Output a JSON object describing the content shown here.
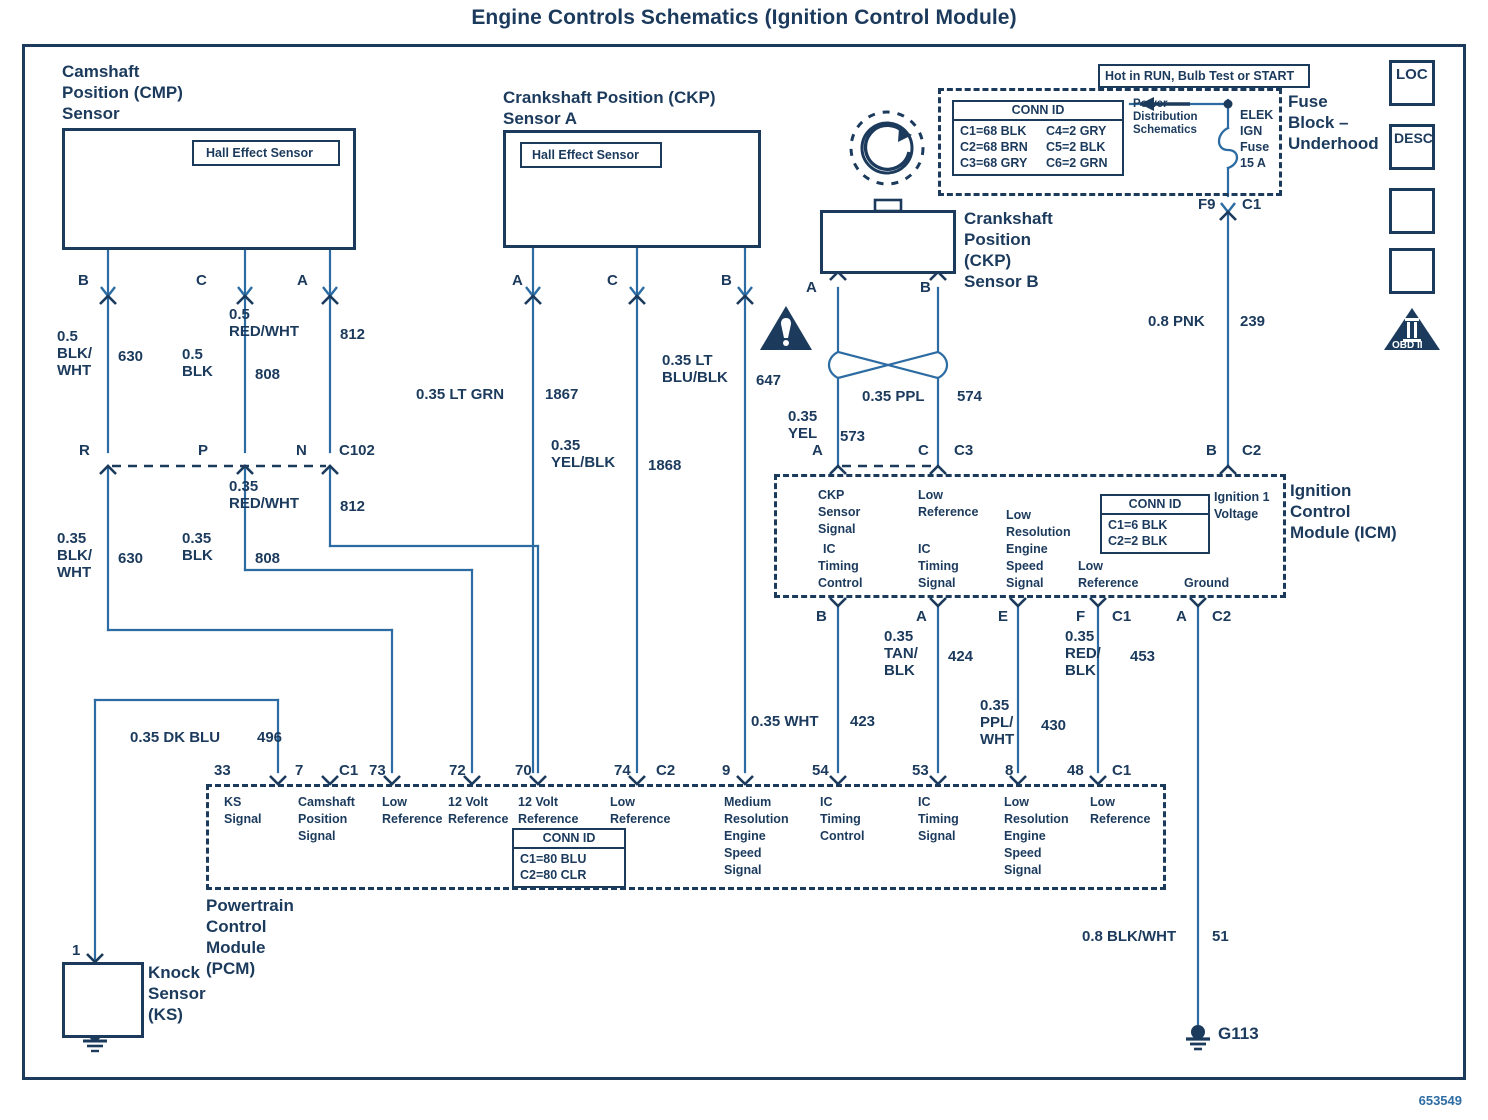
{
  "title": "Engine Controls Schematics (Ignition Control Module)",
  "doc_id": "653549",
  "components": {
    "cmp_sensor": {
      "name_line1": "Camshaft",
      "name_line2": "Position (CMP)",
      "name_line3": "Sensor",
      "inner_label": "Hall Effect Sensor",
      "pins": [
        "B",
        "C",
        "A"
      ]
    },
    "ckp_sensor_a": {
      "name_line1": "Crankshaft Position (CKP)",
      "name_line2": "Sensor A",
      "inner_label": "Hall Effect Sensor",
      "pins": [
        "A",
        "C",
        "B"
      ]
    },
    "ckp_sensor_b": {
      "name_line1": "Crankshaft",
      "name_line2": "Position",
      "name_line3": "(CKP)",
      "name_line4": "Sensor B",
      "pins": [
        "A",
        "B"
      ]
    },
    "knock_sensor": {
      "name_line1": "Knock",
      "name_line2": "Sensor",
      "name_line3": "(KS)",
      "pin": "1"
    },
    "fuse_block": {
      "hot_label": "Hot in RUN, Bulb Test or START",
      "name_line1": "Fuse",
      "name_line2": "Block –",
      "name_line3": "Underhood",
      "power_dist_line1": "Power",
      "power_dist_line2": "Distribution",
      "power_dist_line3": "Schematics",
      "fuse_line1": "ELEK",
      "fuse_line2": "IGN",
      "fuse_line3": "Fuse",
      "fuse_line4": "15 A",
      "out_pin": "F9",
      "out_conn": "C1",
      "conn_id": {
        "title": "CONN ID",
        "rows": [
          [
            "C1=68 BLK",
            "C4=2 GRY"
          ],
          [
            "C2=68 BRN",
            "C5=2 BLK"
          ],
          [
            "C3=68 GRY",
            "C6=2 GRN"
          ]
        ]
      }
    },
    "icm": {
      "name_line1": "Ignition",
      "name_line2": "Control",
      "name_line3": "Module (ICM)",
      "conn_id": {
        "title": "CONN ID",
        "rows": [
          [
            "C1=6 BLK"
          ],
          [
            "C2=2 BLK"
          ]
        ]
      },
      "top_pins": [
        {
          "pin": "A",
          "conn": "",
          "lines": [
            "CKP",
            "Sensor",
            "Signal"
          ],
          "lines2": [
            "IC",
            "Timing",
            "Control"
          ]
        },
        {
          "pin": "C",
          "conn": "C3",
          "lines": [
            "Low",
            "Reference"
          ],
          "lines2": [
            "IC",
            "Timing",
            "Signal"
          ]
        },
        {
          "pin": "B",
          "conn": "C2",
          "lines": [
            "Ignition 1",
            "Voltage"
          ]
        }
      ],
      "mid_label_low_res": [
        "Low",
        "Resolution",
        "Engine",
        "Speed",
        "Signal"
      ],
      "bottom_pins": [
        {
          "pin": "B",
          "conn": ""
        },
        {
          "pin": "A",
          "conn": ""
        },
        {
          "pin": "E",
          "conn": ""
        },
        {
          "pin": "F",
          "conn": "C1",
          "lines": [
            "Low",
            "Reference"
          ]
        },
        {
          "pin": "A",
          "conn": "C2",
          "lines": [
            "Ground"
          ]
        }
      ]
    },
    "pcm": {
      "name_line1": "Powertrain",
      "name_line2": "Control",
      "name_line3": "Module",
      "name_line4": "(PCM)",
      "conn_id": {
        "title": "CONN ID",
        "rows": [
          [
            "C1=80 BLU"
          ],
          [
            "C2=80 CLR"
          ]
        ]
      },
      "terminals": [
        {
          "pin": "33",
          "conn": "",
          "lines": [
            "KS",
            "Signal"
          ]
        },
        {
          "pin": "7",
          "conn": "C1",
          "lines": [
            "Camshaft",
            "Position",
            "Signal"
          ]
        },
        {
          "pin": "73",
          "conn": "",
          "lines": [
            "Low",
            "Reference"
          ]
        },
        {
          "pin": "72",
          "conn": "",
          "lines": [
            "12 Volt",
            "Reference"
          ]
        },
        {
          "pin": "70",
          "conn": "",
          "lines": [
            "12 Volt",
            "Reference"
          ]
        },
        {
          "pin": "74",
          "conn": "C2",
          "lines": [
            "Low",
            "Reference"
          ]
        },
        {
          "pin": "9",
          "conn": "",
          "lines": [
            "Medium",
            "Resolution",
            "Engine",
            "Speed",
            "Signal"
          ]
        },
        {
          "pin": "54",
          "conn": "",
          "lines": [
            "IC",
            "Timing",
            "Control"
          ]
        },
        {
          "pin": "53",
          "conn": "",
          "lines": [
            "IC",
            "Timing",
            "Signal"
          ]
        },
        {
          "pin": "8",
          "conn": "",
          "lines": [
            "Low",
            "Resolution",
            "Engine",
            "Speed",
            "Signal"
          ]
        },
        {
          "pin": "48",
          "conn": "C1",
          "lines": [
            "Low",
            "Reference"
          ]
        }
      ]
    },
    "connector_c102": {
      "label": "C102",
      "pins": [
        "R",
        "P",
        "N"
      ]
    },
    "ground": {
      "label": "G113"
    }
  },
  "wires": [
    {
      "id": "w630a",
      "gauge_color": "0.5\nBLK/\nWHT",
      "circuit": "630"
    },
    {
      "id": "w808a",
      "gauge_color": "0.5\nBLK",
      "circuit": "808"
    },
    {
      "id": "w812a",
      "gauge_color": "0.5\nRED/WHT",
      "circuit": "812"
    },
    {
      "id": "w630b",
      "gauge_color": "0.35\nBLK/\nWHT",
      "circuit": "630"
    },
    {
      "id": "w808b",
      "gauge_color": "0.35\nBLK",
      "circuit": "808"
    },
    {
      "id": "w812b",
      "gauge_color": "0.35\nRED/WHT",
      "circuit": "812"
    },
    {
      "id": "w1867",
      "gauge_color": "0.35 LT GRN",
      "circuit": "1867"
    },
    {
      "id": "w1868",
      "gauge_color": "0.35\nYEL/BLK",
      "circuit": "1868"
    },
    {
      "id": "w647",
      "gauge_color": "0.35 LT\nBLU/BLK",
      "circuit": "647"
    },
    {
      "id": "w573",
      "gauge_color": "0.35\nYEL",
      "circuit": "573"
    },
    {
      "id": "w574",
      "gauge_color": "0.35 PPL",
      "circuit": "574"
    },
    {
      "id": "w239",
      "gauge_color": "0.8 PNK",
      "circuit": "239"
    },
    {
      "id": "w496",
      "gauge_color": "0.35 DK BLU",
      "circuit": "496"
    },
    {
      "id": "w423",
      "gauge_color": "0.35 WHT",
      "circuit": "423"
    },
    {
      "id": "w424",
      "gauge_color": "0.35\nTAN/\nBLK",
      "circuit": "424"
    },
    {
      "id": "w430",
      "gauge_color": "0.35\nPPL/\nWHT",
      "circuit": "430"
    },
    {
      "id": "w453",
      "gauge_color": "0.35\nRED/\nBLK",
      "circuit": "453"
    },
    {
      "id": "w51",
      "gauge_color": "0.8 BLK/WHT",
      "circuit": "51"
    }
  ],
  "nav_buttons": [
    {
      "name": "loc-button",
      "label": "LOC"
    },
    {
      "name": "desc-button",
      "label": "DESC"
    },
    {
      "name": "next-button",
      "label": "→"
    },
    {
      "name": "prev-button",
      "label": "←"
    },
    {
      "name": "obd2-button",
      "label": "OBD II"
    }
  ],
  "colors": {
    "ink": "#1b3a5c",
    "wire": "#2d6ca2",
    "background": "#ffffff"
  }
}
